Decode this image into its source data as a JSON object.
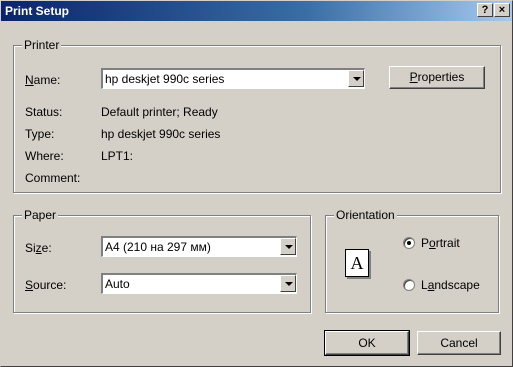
{
  "window": {
    "title": "Print Setup",
    "help_label": "?",
    "close_label": "×"
  },
  "printer": {
    "group_label": "Printer",
    "name_label_prefix": "",
    "name_label_access": "N",
    "name_label_rest": "ame:",
    "name_value": "hp deskjet 990c series",
    "properties_access": "P",
    "properties_rest": "roperties",
    "status_label": "Status:",
    "status_value": "Default printer; Ready",
    "type_label": "Type:",
    "type_value": "hp deskjet 990c series",
    "where_label": "Where:",
    "where_value": "LPT1:",
    "comment_label": "Comment:",
    "comment_value": ""
  },
  "paper": {
    "group_label": "Paper",
    "size_label_prefix": "Si",
    "size_label_access": "z",
    "size_label_rest": "e:",
    "size_value": "A4 (210 на 297 мм)",
    "source_label_access": "S",
    "source_label_rest": "ource:",
    "source_value": "Auto"
  },
  "orientation": {
    "group_label": "Orientation",
    "icon_glyph": "A",
    "portrait_prefix": "P",
    "portrait_access": "o",
    "portrait_rest": "rtrait",
    "landscape_prefix": "L",
    "landscape_access": "a",
    "landscape_rest": "ndscape",
    "selected": "Portrait"
  },
  "buttons": {
    "ok_label": "OK",
    "cancel_label": "Cancel"
  }
}
